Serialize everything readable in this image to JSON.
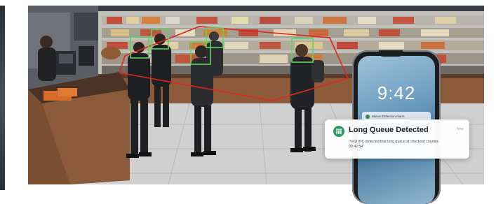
{
  "phone": {
    "time": "9:42",
    "mini_notification": "Motion Detection Alarm"
  },
  "notification": {
    "title": "Long Queue Detected",
    "time": "Now",
    "message_line1": "\"VIGI IPC detected that long queue at checkout counter.",
    "message_line2": "09:42:54\""
  },
  "colors": {
    "detection_box": "#5cd65c",
    "queue_zone": "#e0261f",
    "notification_icon": "#2f9a65"
  },
  "icons": {
    "notification_icon": "queue-people-icon"
  }
}
